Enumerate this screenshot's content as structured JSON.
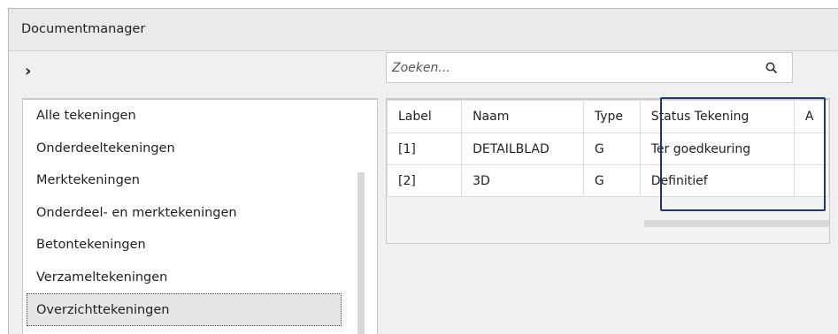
{
  "window": {
    "title": "Documentmanager"
  },
  "toolbar": {
    "expand_glyph": "›"
  },
  "search": {
    "placeholder": "Zoeken..."
  },
  "categories": [
    {
      "label": "Alle tekeningen"
    },
    {
      "label": "Onderdeeltekeningen"
    },
    {
      "label": "Merktekeningen"
    },
    {
      "label": "Onderdeel- en merktekeningen"
    },
    {
      "label": "Betontekeningen"
    },
    {
      "label": "Verzameltekeningen"
    },
    {
      "label": "Overzichttekeningen",
      "selected": true
    }
  ],
  "table": {
    "columns": [
      "Label",
      "Naam",
      "Type",
      "Status Tekening",
      "A"
    ],
    "rows": [
      [
        "[1]",
        "DETAILBLAD",
        "G",
        "Ter goedkeuring",
        ""
      ],
      [
        "[2]",
        "3D",
        "G",
        "Definitief",
        ""
      ]
    ]
  },
  "colors": {
    "highlight_border": "#1b3a6b",
    "selected_bg": "#e6e6e6"
  }
}
